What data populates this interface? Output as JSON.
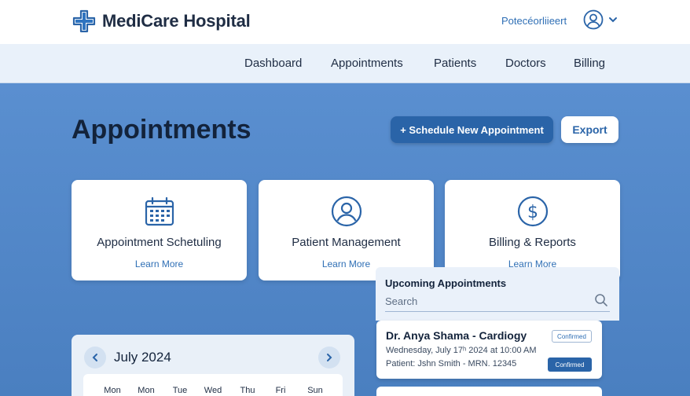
{
  "header": {
    "brand_name": "MediCare Hospital",
    "portal_link": "Potecéorliieert"
  },
  "nav": {
    "items": [
      "Dashboard",
      "Appointments",
      "Patients",
      "Doctors",
      "Billing"
    ]
  },
  "page": {
    "title": "Appointments",
    "primary_button": "+ Schedule New Appointment",
    "secondary_button": "Export"
  },
  "cards": [
    {
      "title": "Appointment Schetuling",
      "link": "Learn More",
      "icon": "calendar-icon"
    },
    {
      "title": "Patient Management",
      "link": "Learn More",
      "icon": "user-circle-icon"
    },
    {
      "title": "Billing & Reports",
      "link": "Learn More",
      "icon": "dollar-circle-icon"
    }
  ],
  "upcoming": {
    "title": "Upcoming Appointments",
    "search_placeholder": "Search",
    "appointments": [
      {
        "doctor": "Dr. Anya Shama - Cardiogy",
        "time": "Wednesday, July 17ʰ 2024 at 10:00 AM",
        "patient": "Patient: Jshn Smith - MRN. 12345",
        "status_outline": "Confirmed",
        "status_solid": "Confirmed"
      }
    ]
  },
  "calendar": {
    "month": "July 2024",
    "weekdays": [
      "Mon",
      "Mon",
      "Tue",
      "Wed",
      "Thu",
      "Fri",
      "Sun"
    ]
  },
  "colors": {
    "primary": "#2a64a8",
    "background": "#4f86c6",
    "text_dark": "#13233b"
  }
}
